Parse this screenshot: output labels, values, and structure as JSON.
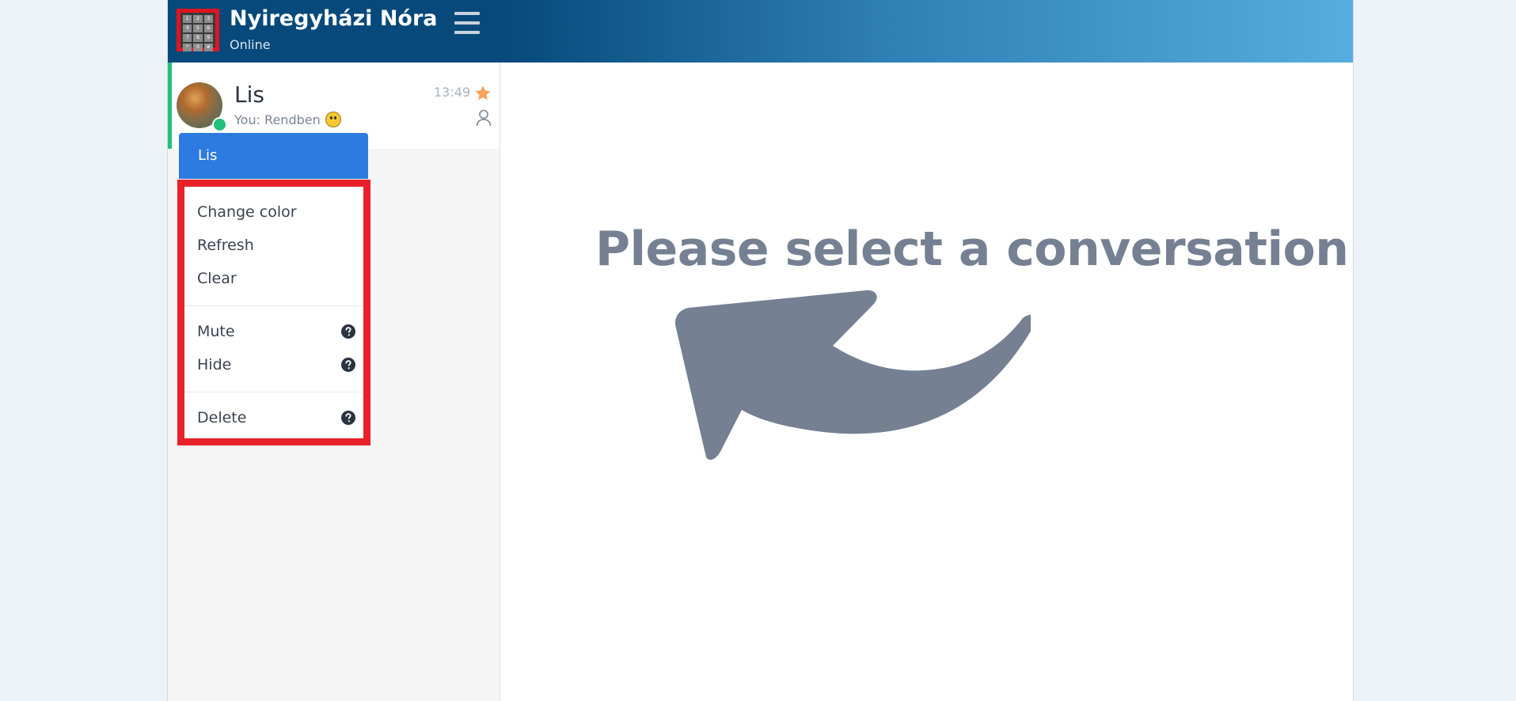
{
  "header": {
    "user_name": "Nyiregyházi Nóra",
    "status": "Online",
    "logo_keys": [
      "1",
      "2",
      "3",
      "4",
      "5",
      "6",
      "7",
      "8",
      "9",
      "*",
      "0",
      "#"
    ]
  },
  "conversation": {
    "name": "Lis",
    "preview": "You: Rendben",
    "time": "13:49"
  },
  "context_menu": {
    "title": "Lis",
    "items": {
      "change_color": "Change color",
      "refresh": "Refresh",
      "clear": "Clear",
      "mute": "Mute",
      "hide": "Hide",
      "delete": "Delete"
    }
  },
  "main": {
    "placeholder": "Please select a conversation"
  },
  "colors": {
    "header_dark": "#06497a",
    "accent_blue": "#2d7ae0",
    "online_green": "#20c27a",
    "highlight_red": "#e8202a",
    "star_orange": "#f7a15c",
    "placeholder_gray": "#758093"
  },
  "icons": [
    "keypad-logo-icon",
    "hamburger-menu-icon",
    "star-icon",
    "person-icon",
    "question-circle-icon",
    "curved-arrow-icon"
  ]
}
